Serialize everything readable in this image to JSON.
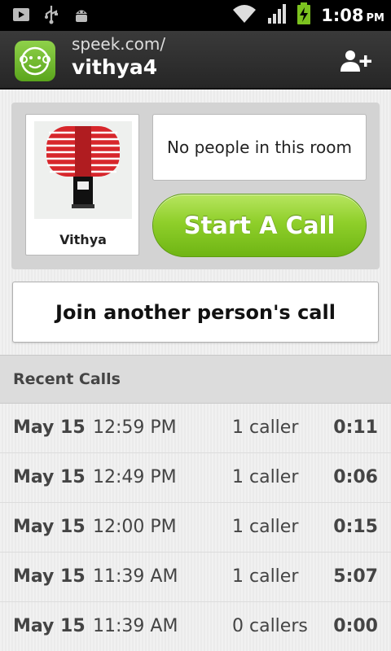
{
  "status_bar": {
    "time": "1:08",
    "ampm": "PM",
    "icons": [
      "play-store-icon",
      "usb-icon",
      "android-debug-icon",
      "wifi-icon",
      "signal-icon",
      "battery-charging-icon"
    ]
  },
  "action_bar": {
    "subtitle": "speek.com/",
    "title": "vithya4",
    "logo_icon": "monkey-logo-icon",
    "add_person_icon": "add-person-icon"
  },
  "room": {
    "profile_name": "Vithya",
    "people_status": "No people in this room",
    "start_call_label": "Start A Call"
  },
  "join_label": "Join another person's call",
  "recent": {
    "header": "Recent Calls",
    "calls": [
      {
        "date": "May 15",
        "time": "12:59 PM",
        "callers": "1 caller",
        "duration": "0:11"
      },
      {
        "date": "May 15",
        "time": "12:49 PM",
        "callers": "1 caller",
        "duration": "0:06"
      },
      {
        "date": "May 15",
        "time": "12:00 PM",
        "callers": "1 caller",
        "duration": "0:15"
      },
      {
        "date": "May 15",
        "time": "11:39 AM",
        "callers": "1 caller",
        "duration": "5:07"
      },
      {
        "date": "May 15",
        "time": "11:39 AM",
        "callers": "0 callers",
        "duration": "0:00"
      }
    ]
  },
  "colors": {
    "accent_green": "#7cc21f",
    "action_bar": "#2f2f2f",
    "status_bar": "#000000"
  }
}
